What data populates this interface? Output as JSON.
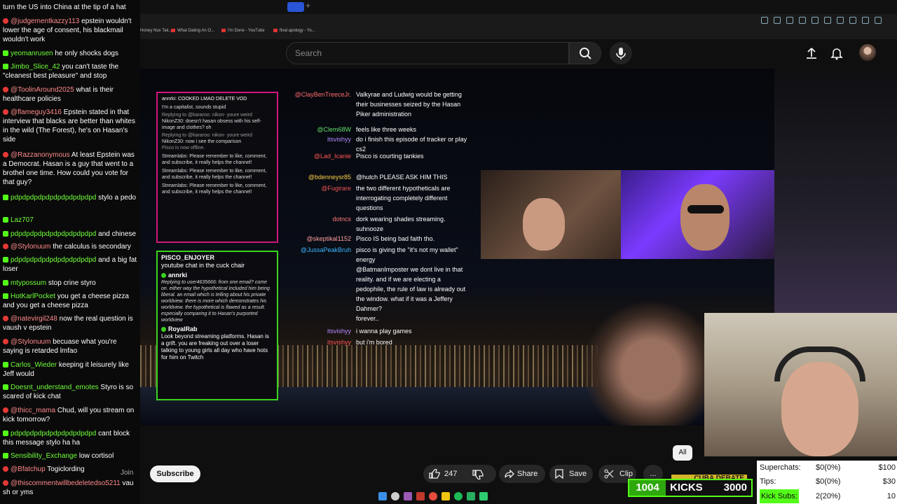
{
  "browser": {
    "bookmarks": [
      "Honey Nux Tak...",
      "What Dating An O...",
      "I'm Done - YouTube",
      "final apology - Yo..."
    ]
  },
  "header": {
    "search_placeholder": "Search"
  },
  "chat": {
    "messages": [
      {
        "platform": "",
        "user": "",
        "text": "turn the US into China at the tip of a hat"
      },
      {
        "platform": "youtube",
        "user": "@judgementkazzy113",
        "text": "epstein wouldn't lower the age of consent, his blackmail wouldn't work"
      },
      {
        "platform": "kick",
        "user": "yeomanrusen",
        "text": "he only shocks dogs"
      },
      {
        "platform": "kick",
        "user": "Jimbo_Slice_42",
        "text": "you can't taste the \"cleanest best pleasure\" and stop"
      },
      {
        "platform": "youtube",
        "user": "@ToolinAround2025",
        "text": "what is their healthcare policies"
      },
      {
        "platform": "youtube",
        "user": "@flameguy3416",
        "text": "Epstein stated in that interview that blacks are better than whites in the wild (The Forest), he's on Hasan's side"
      },
      {
        "platform": "youtube",
        "user": "@Razzanonymous",
        "text": "At least Epstein was a Democrat. Hasan is a guy that went to a brothel one time. How could you vote for that guy?"
      },
      {
        "platform": "kick",
        "user": "pdpdpdpdpdpdpdpdpdpdpd",
        "text": "stylo a pedo"
      },
      {
        "platform": "kick",
        "user": "Laz707",
        "text": ""
      },
      {
        "platform": "kick",
        "user": "pdpdpdpdpdpdpdpdpdpdpd",
        "text": "and chinese"
      },
      {
        "platform": "youtube",
        "user": "@Stylonuum",
        "text": "the calculus is secondary"
      },
      {
        "platform": "kick",
        "user": "pdpdpdpdpdpdpdpdpdpdpd",
        "text": "and a big fat loser"
      },
      {
        "platform": "kick",
        "user": "mtypossum",
        "text": "stop crine styro"
      },
      {
        "platform": "kick",
        "user": "HotKarlPocket",
        "text": "you get a cheese pizza and you get a cheese pizza"
      },
      {
        "platform": "youtube",
        "user": "@natevirgil248",
        "text": "now the real question is vaush v epstein"
      },
      {
        "platform": "youtube",
        "user": "@Stylonuum",
        "text": "becuase what you're saying is retarded lmfao"
      },
      {
        "platform": "kick",
        "user": "Carlos_Wieder",
        "text": "keeping it leisurely like Jeff would"
      },
      {
        "platform": "kick",
        "user": "Doesnt_understand_emotes",
        "text": "Styro is so scared of kick chat"
      },
      {
        "platform": "youtube",
        "user": "@thicc_mama",
        "text": "Chud, will you stream on kick tomorrow?"
      },
      {
        "platform": "kick",
        "user": "pdpdpdpdpdpdpdpdpdpdpd",
        "text": "cant block this message stylo ha ha"
      },
      {
        "platform": "kick",
        "user": "Sensibility_Exchange",
        "text": "low cortisol"
      },
      {
        "platform": "youtube",
        "user": "@Bfatchup",
        "text": "Togiclording"
      },
      {
        "platform": "youtube",
        "user": "@thiscommentwillbedeletedso5211",
        "text": "vau sh or yms"
      }
    ]
  },
  "overlay_box1": {
    "title": "annrki: COOKED LMAO DELETE VOD",
    "lines": [
      "I'm a capitalist, sounds stupid",
      "Replying to @kararoo: nikon- youre weird",
      "NikonZ30: doesn't hasan obsess with his self-image and clothes? oh",
      "Replying to @kararoo: nikon- youre weird",
      "NikonZ30: now i see the comparison",
      "Pisco is now offline."
    ],
    "streamlabs": "Streamlabs: Please remember to like, comment, and subscribe, it really helps the channel!"
  },
  "overlay_box2": {
    "user1": "PISCO_ENJOYER",
    "msg1": "youtube chat in the cuck chair",
    "user2": "annrki",
    "msg2": "Replying to user4635666: from one email? come on. either way the hypothetical included him being liberal. an email which is telling about his private worldview. there is more which demonstrates his worldview. the hypothetical is flawed as a result. especially comparing it to Hasan's purported worldview",
    "user3": "RoyalRab",
    "msg3": "Look beyond streaming platforms. Hasan is a grift. you are freaking out over a loser talking to young girls all day who have hots for him on Twitch"
  },
  "stream_chat": [
    {
      "user": "@ClayBenTreeceJr.",
      "text": "Valkyrae and Ludwig would be getting their businesses seized by the Hasan Piker administration"
    },
    {
      "user": "@Clem68W",
      "text": "feels like three weeks"
    },
    {
      "user": "itsvishyy",
      "text": "do i finish this episode of tracker or play cs2"
    },
    {
      "user": "@Lad_Icanie",
      "text": "Pisco is courting tankies"
    },
    {
      "user": "@bdenneysr85",
      "text": "@hutch PLEASE ASK HIM THIS"
    },
    {
      "user": "@Fugirare",
      "text": "the two different hypotheticals are interrogating completely different questions"
    },
    {
      "user": "dotncs",
      "text": "dork wearing shades streaming. suhnooze"
    },
    {
      "user": "@skeptikal1152",
      "text": "Pisco IS being bad faith tho."
    },
    {
      "user": "@JussaPeakBruh",
      "text": "pisco is giving the \"it's not my wallet\" energy"
    },
    {
      "user": "",
      "text": "@BatmanImposter we dont live in that reality. and if we are electing a pedophile, the rule of law is already out the window. what if it was a Jeffery Dahmer?"
    },
    {
      "user": "",
      "text": "forever.."
    },
    {
      "user": "itsvishyy",
      "text": "i wanna play games"
    },
    {
      "user": "itsvishyy",
      "text": "but i'm bored"
    }
  ],
  "controls": {
    "join": "Join",
    "subscribe": "Subscribe",
    "likes": "247",
    "share": "Share",
    "save": "Save",
    "clip": "Clip",
    "more": "...",
    "all_chip": "All"
  },
  "kicks_goal": {
    "count": "1004",
    "label": "KICKS",
    "goal": "3000",
    "banner": "CUBA DEBATE"
  },
  "stats": {
    "superchats_label": "Superchats:",
    "superchats_value": "$0(0%)",
    "superchats_goal": "$100",
    "tips_label": "Tips:",
    "tips_value": "$0(0%)",
    "tips_goal": "$30",
    "kicksubs_label": "Kick Subs:",
    "kicksubs_value": "2(20%)",
    "kicksubs_goal": "10"
  },
  "colors": {
    "youtube_red": "#e53935",
    "kick_green": "#53fc18",
    "overlay_pink": "#d0157e"
  }
}
